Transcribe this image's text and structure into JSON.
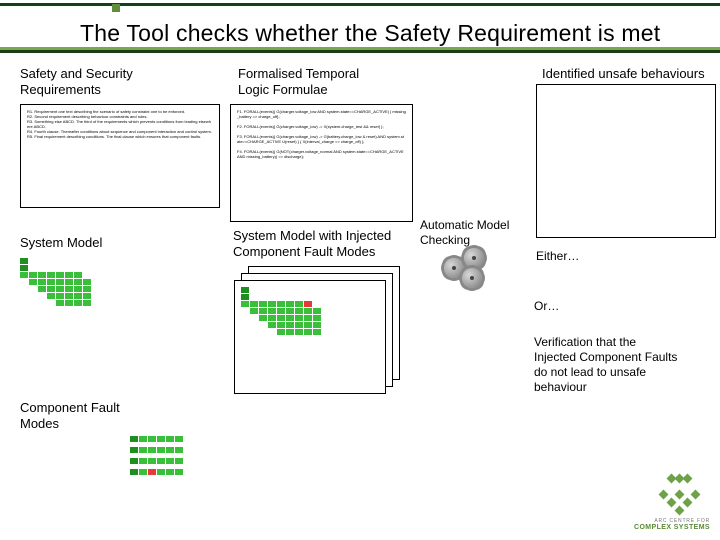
{
  "title": "The Tool checks whether the Safety Requirement is met",
  "labels": {
    "safety_sec": "Safety and Security\nRequirements",
    "formalised": "Formalised Temporal\nLogic Formulae",
    "identified": "Identified unsafe behaviours",
    "system_model": "System Model",
    "injected": "System Model with Injected\nComponent Fault Modes",
    "automatic": "Automatic Model\nChecking",
    "either": "Either…",
    "or": "Or…",
    "verify": "Verification that the\nInjected Component Faults\ndo not lead to unsafe\nbehaviour",
    "cfm": "Component Fault\nModes"
  },
  "logo": {
    "line1": "ARC CENTRE FOR",
    "line2": "COMPLEX SYSTEMS"
  },
  "filler": {
    "reqs": "R1. Requirement one text describing the scenario of safety constraint one to be enforced.\nR2. Second requirement describing behaviour constraints and rules.\nR3. Something else ABCD. The third of the requirements which prevents conditions from leading elsewhere ABCD.\nR4. Fourth clause. Thereafter conditions about sequence and component interaction and control system.\nR5. Final requirement describing conditions. The final clause which ensures that component faults.",
    "ltl": "F1. FORALL(events){ G(charger.voltage_low AND system.state==CHARGE_ACTIVE) | missing_battery => charge_off};\n\nF2. FORALL(events){ G(charger.voltage_low) -> X(system.charge_test && reset) };\n\nF3. FORALL(events){ G(charger.voltage_low) -> G(battery.charge_low & reset) AND system.state==CHARGE_ACTIVE U(reset) } { X(interval_charge => charge_off) };\n\nF4. FORALL(events){ G(NOT(charger.voltage_normal AND system.state==CHARGE_ACTIVE AND missing_battery)) => discharge};"
  }
}
